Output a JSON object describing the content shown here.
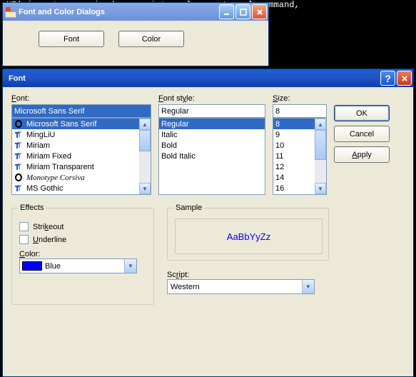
{
  "cmd_line": "sXR' is not recognized as an internal or external command,",
  "parent": {
    "title": "Font and Color Dialogs",
    "font_btn": "Font",
    "color_btn": "Color"
  },
  "dialog": {
    "title": "Font",
    "labels": {
      "font": "Font:",
      "style": "Font style:",
      "size": "Size:",
      "effects": "Effects",
      "strikeout": "Strikeout",
      "underline": "Underline",
      "color": "Color:",
      "sample": "Sample",
      "script": "Script:"
    },
    "buttons": {
      "ok": "OK",
      "cancel": "Cancel",
      "apply": "Apply"
    },
    "font_input": "Microsoft Sans Serif",
    "style_input": "Regular",
    "size_input": "8",
    "font_list": [
      "Microsoft Sans Serif",
      "MingLiU",
      "Miriam",
      "Miriam Fixed",
      "Miriam Transparent",
      "Monotype Corsiva",
      "MS Gothic"
    ],
    "style_list": [
      "Regular",
      "Italic",
      "Bold",
      "Bold Italic"
    ],
    "size_list": [
      "8",
      "9",
      "10",
      "11",
      "12",
      "14",
      "16"
    ],
    "color_name": "Blue",
    "color_hex": "#0000ff",
    "sample_text": "AaBbYyZz",
    "script_value": "Western"
  }
}
